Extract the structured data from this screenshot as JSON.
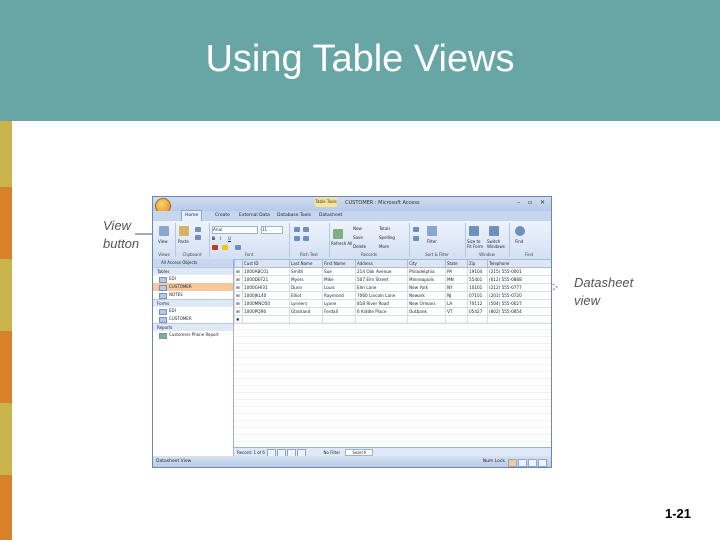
{
  "slide": {
    "title": "Using Table Views",
    "slide_number": "1-21",
    "callouts": {
      "view_button": [
        "View",
        "button"
      ],
      "datasheet_view": [
        "Datasheet",
        "view"
      ]
    },
    "colors": {
      "header": "#67a6a5",
      "stripes": [
        "#c8b44a",
        "#d9822b",
        "#c8b44a",
        "#d9822b",
        "#c8b44a",
        "#d9822b",
        "#c8b44a"
      ]
    }
  },
  "app": {
    "window_title": "CUSTOMER : Microsoft Access",
    "context_tab": "Table Tools",
    "tabs": [
      "Home",
      "Create",
      "External Data",
      "Database Tools",
      "Datasheet"
    ],
    "active_tab": "Home",
    "ribbon_groups": [
      {
        "label": "Views",
        "buttons": [
          "View"
        ]
      },
      {
        "label": "Clipboard",
        "buttons": [
          "Paste"
        ]
      },
      {
        "label": "Font",
        "buttons": [
          "Arial",
          "11",
          "B",
          "I",
          "U"
        ]
      },
      {
        "label": "Rich Text",
        "buttons": []
      },
      {
        "label": "Records",
        "buttons": [
          "New",
          "Save",
          "Delete",
          "Refresh All",
          "Totals",
          "Spelling",
          "More"
        ]
      },
      {
        "label": "Sort & Filter",
        "buttons": [
          "Filter"
        ]
      },
      {
        "label": "Window",
        "buttons": [
          "Size to Fit Form",
          "Switch Windows"
        ]
      },
      {
        "label": "Find",
        "buttons": [
          "Find"
        ]
      }
    ],
    "nav_pane": {
      "header": "All Access Objects",
      "sections": [
        {
          "name": "Tables",
          "items": [
            "EDI",
            "CUSTOMER",
            "NOTES"
          ],
          "selected": "CUSTOMER"
        },
        {
          "name": "Forms",
          "items": [
            "EDI",
            "CUSTOMER"
          ]
        },
        {
          "name": "Reports",
          "items": [
            "Customers Phone Report"
          ]
        }
      ]
    },
    "datasheet": {
      "columns": [
        "Cust ID",
        "Last Name",
        "First Name",
        "Address",
        "City",
        "State",
        "Zip",
        "Telephone"
      ],
      "rows": [
        [
          "1000ABC01",
          "Smith",
          "Sue",
          "214 Oak Avenue",
          "Philadelphia",
          "PA",
          "19104",
          "(215) 555-0001"
        ],
        [
          "1000DEF21",
          "Myers",
          "Mike",
          "507 Elm Street",
          "Minneapolis",
          "MN",
          "55401",
          "(612) 555-0888"
        ],
        [
          "1000GHI31",
          "Dunn",
          "Louis",
          "Elm Lane",
          "New York",
          "NY",
          "10101",
          "(212) 555-0777"
        ],
        [
          "1000JKL40",
          "Elliot",
          "Raymond",
          "7060 Lincoln Lane",
          "Newark",
          "NJ",
          "07101",
          "(201) 555-0720"
        ],
        [
          "1000MNO50",
          "Lyneers",
          "Lyane",
          "818 River Road",
          "New Orleans",
          "LA",
          "70112",
          "(504) 555-0027"
        ],
        [
          "1000PQR6",
          "Gladrand",
          "Ferdall",
          "6 Kiddle Place",
          "Outbank",
          "VT",
          "05427",
          "(802) 555-0854"
        ]
      ]
    },
    "record_nav": "Record: 1 of 6",
    "record_nav_extra": [
      "No Filter",
      "Search"
    ],
    "status_left": "Datasheet View",
    "status_right": "Num Lock"
  }
}
